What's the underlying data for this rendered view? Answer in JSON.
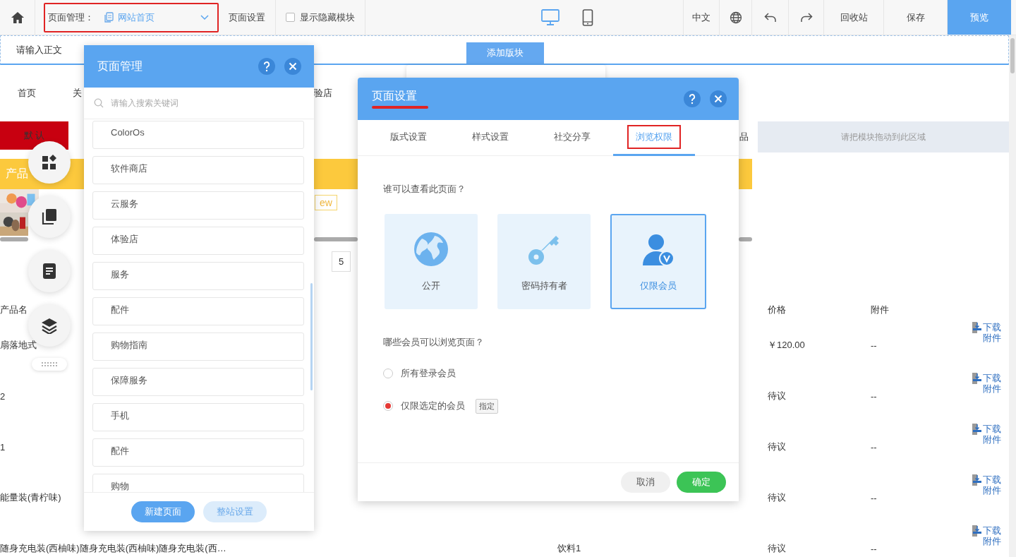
{
  "toolbar": {
    "page_manager_label": "页面管理：",
    "current_page": "网站首页",
    "page_settings": "页面设置",
    "show_hidden": {
      "label": "显示隐藏模块",
      "checked": false
    },
    "devices": [
      {
        "kind": "desktop",
        "selected": true
      },
      {
        "kind": "mobile",
        "selected": false
      }
    ],
    "language": "中文",
    "trash": "回收站",
    "save": "保存",
    "preview": "预览"
  },
  "canvas": {
    "text_placeholder": "请输入正文",
    "add_block": "添加版块",
    "nav": [
      "首页",
      "关",
      "验店"
    ],
    "default_tag": "默 认",
    "category_fragment": "品",
    "drop_zone": "请把模块拖动到此区域",
    "banner_title": "产品",
    "tag_fragment": "ew",
    "pages": [
      "5"
    ],
    "table": {
      "columns": [
        "产品名",
        "价格",
        "附件"
      ],
      "rows": [
        {
          "name": "扇落地式",
          "price": "￥120.00",
          "attachment": "--",
          "download": "下载附件"
        },
        {
          "name": "2",
          "price": "待议",
          "attachment": "--",
          "download": "下载附件"
        },
        {
          "name": "1",
          "price": "待议",
          "attachment": "--",
          "download": "下载附件"
        },
        {
          "name": "能量装(青柠味)",
          "price": "待议",
          "attachment": "--",
          "download": "下载附件"
        },
        {
          "name": "随身充电装(西柚味)随身充电装(西柚味)随身充电装(西…",
          "category": "饮料1",
          "price": "待议",
          "attachment": "--",
          "download": "下载附件"
        }
      ]
    }
  },
  "page_manager": {
    "title": "页面管理",
    "search": {
      "placeholder": "请输入搜索关键词"
    },
    "pages": [
      "ColorOs",
      "软件商店",
      "云服务",
      "体验店",
      "服务",
      "配件",
      "购物指南",
      "保障服务",
      "手机",
      "配件",
      "购物"
    ],
    "buttons": [
      {
        "kind": "primary",
        "label": "新建页面"
      },
      {
        "kind": "secondary",
        "label": "整站设置"
      }
    ]
  },
  "page_settings": {
    "title": "页面设置",
    "tabs": [
      {
        "label": "版式设置",
        "selected": false
      },
      {
        "label": "样式设置",
        "selected": false
      },
      {
        "label": "社交分享",
        "selected": false
      },
      {
        "label": "浏览权限",
        "selected": true
      }
    ],
    "question": "谁可以查看此页面？",
    "access_options": [
      {
        "kind": "public",
        "label": "公开",
        "selected": false
      },
      {
        "kind": "password",
        "label": "密码持有者",
        "selected": false
      },
      {
        "kind": "members",
        "label": "仅限会员",
        "selected": true
      }
    ],
    "member_question": "哪些会员可以浏览页面？",
    "member_scope": [
      {
        "label": "所有登录会员",
        "selected": false
      },
      {
        "label": "仅限选定的会员",
        "selected": true,
        "action": "指定"
      }
    ],
    "buttons": [
      {
        "kind": "cancel",
        "label": "取消"
      },
      {
        "kind": "confirm",
        "label": "确定"
      }
    ]
  }
}
